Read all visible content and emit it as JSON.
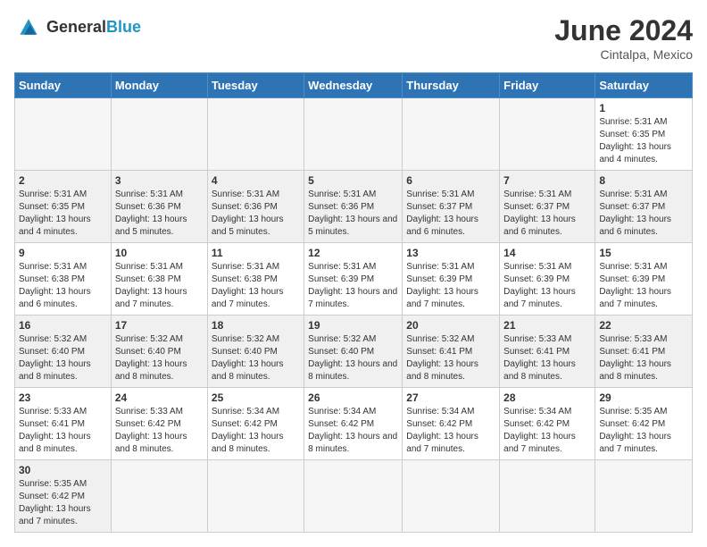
{
  "header": {
    "logo_general": "General",
    "logo_blue": "Blue",
    "month_title": "June 2024",
    "location": "Cintalpa, Mexico"
  },
  "weekdays": [
    "Sunday",
    "Monday",
    "Tuesday",
    "Wednesday",
    "Thursday",
    "Friday",
    "Saturday"
  ],
  "weeks": [
    [
      {
        "day": "",
        "info": ""
      },
      {
        "day": "",
        "info": ""
      },
      {
        "day": "",
        "info": ""
      },
      {
        "day": "",
        "info": ""
      },
      {
        "day": "",
        "info": ""
      },
      {
        "day": "",
        "info": ""
      },
      {
        "day": "1",
        "info": "Sunrise: 5:31 AM\nSunset: 6:35 PM\nDaylight: 13 hours and 4 minutes."
      }
    ],
    [
      {
        "day": "2",
        "info": "Sunrise: 5:31 AM\nSunset: 6:35 PM\nDaylight: 13 hours and 4 minutes."
      },
      {
        "day": "3",
        "info": "Sunrise: 5:31 AM\nSunset: 6:36 PM\nDaylight: 13 hours and 5 minutes."
      },
      {
        "day": "4",
        "info": "Sunrise: 5:31 AM\nSunset: 6:36 PM\nDaylight: 13 hours and 5 minutes."
      },
      {
        "day": "5",
        "info": "Sunrise: 5:31 AM\nSunset: 6:36 PM\nDaylight: 13 hours and 5 minutes."
      },
      {
        "day": "6",
        "info": "Sunrise: 5:31 AM\nSunset: 6:37 PM\nDaylight: 13 hours and 6 minutes."
      },
      {
        "day": "7",
        "info": "Sunrise: 5:31 AM\nSunset: 6:37 PM\nDaylight: 13 hours and 6 minutes."
      },
      {
        "day": "8",
        "info": "Sunrise: 5:31 AM\nSunset: 6:37 PM\nDaylight: 13 hours and 6 minutes."
      }
    ],
    [
      {
        "day": "9",
        "info": "Sunrise: 5:31 AM\nSunset: 6:38 PM\nDaylight: 13 hours and 6 minutes."
      },
      {
        "day": "10",
        "info": "Sunrise: 5:31 AM\nSunset: 6:38 PM\nDaylight: 13 hours and 7 minutes."
      },
      {
        "day": "11",
        "info": "Sunrise: 5:31 AM\nSunset: 6:38 PM\nDaylight: 13 hours and 7 minutes."
      },
      {
        "day": "12",
        "info": "Sunrise: 5:31 AM\nSunset: 6:39 PM\nDaylight: 13 hours and 7 minutes."
      },
      {
        "day": "13",
        "info": "Sunrise: 5:31 AM\nSunset: 6:39 PM\nDaylight: 13 hours and 7 minutes."
      },
      {
        "day": "14",
        "info": "Sunrise: 5:31 AM\nSunset: 6:39 PM\nDaylight: 13 hours and 7 minutes."
      },
      {
        "day": "15",
        "info": "Sunrise: 5:31 AM\nSunset: 6:39 PM\nDaylight: 13 hours and 7 minutes."
      }
    ],
    [
      {
        "day": "16",
        "info": "Sunrise: 5:32 AM\nSunset: 6:40 PM\nDaylight: 13 hours and 8 minutes."
      },
      {
        "day": "17",
        "info": "Sunrise: 5:32 AM\nSunset: 6:40 PM\nDaylight: 13 hours and 8 minutes."
      },
      {
        "day": "18",
        "info": "Sunrise: 5:32 AM\nSunset: 6:40 PM\nDaylight: 13 hours and 8 minutes."
      },
      {
        "day": "19",
        "info": "Sunrise: 5:32 AM\nSunset: 6:40 PM\nDaylight: 13 hours and 8 minutes."
      },
      {
        "day": "20",
        "info": "Sunrise: 5:32 AM\nSunset: 6:41 PM\nDaylight: 13 hours and 8 minutes."
      },
      {
        "day": "21",
        "info": "Sunrise: 5:33 AM\nSunset: 6:41 PM\nDaylight: 13 hours and 8 minutes."
      },
      {
        "day": "22",
        "info": "Sunrise: 5:33 AM\nSunset: 6:41 PM\nDaylight: 13 hours and 8 minutes."
      }
    ],
    [
      {
        "day": "23",
        "info": "Sunrise: 5:33 AM\nSunset: 6:41 PM\nDaylight: 13 hours and 8 minutes."
      },
      {
        "day": "24",
        "info": "Sunrise: 5:33 AM\nSunset: 6:42 PM\nDaylight: 13 hours and 8 minutes."
      },
      {
        "day": "25",
        "info": "Sunrise: 5:34 AM\nSunset: 6:42 PM\nDaylight: 13 hours and 8 minutes."
      },
      {
        "day": "26",
        "info": "Sunrise: 5:34 AM\nSunset: 6:42 PM\nDaylight: 13 hours and 8 minutes."
      },
      {
        "day": "27",
        "info": "Sunrise: 5:34 AM\nSunset: 6:42 PM\nDaylight: 13 hours and 7 minutes."
      },
      {
        "day": "28",
        "info": "Sunrise: 5:34 AM\nSunset: 6:42 PM\nDaylight: 13 hours and 7 minutes."
      },
      {
        "day": "29",
        "info": "Sunrise: 5:35 AM\nSunset: 6:42 PM\nDaylight: 13 hours and 7 minutes."
      }
    ],
    [
      {
        "day": "30",
        "info": "Sunrise: 5:35 AM\nSunset: 6:42 PM\nDaylight: 13 hours and 7 minutes."
      },
      {
        "day": "",
        "info": ""
      },
      {
        "day": "",
        "info": ""
      },
      {
        "day": "",
        "info": ""
      },
      {
        "day": "",
        "info": ""
      },
      {
        "day": "",
        "info": ""
      },
      {
        "day": "",
        "info": ""
      }
    ]
  ]
}
